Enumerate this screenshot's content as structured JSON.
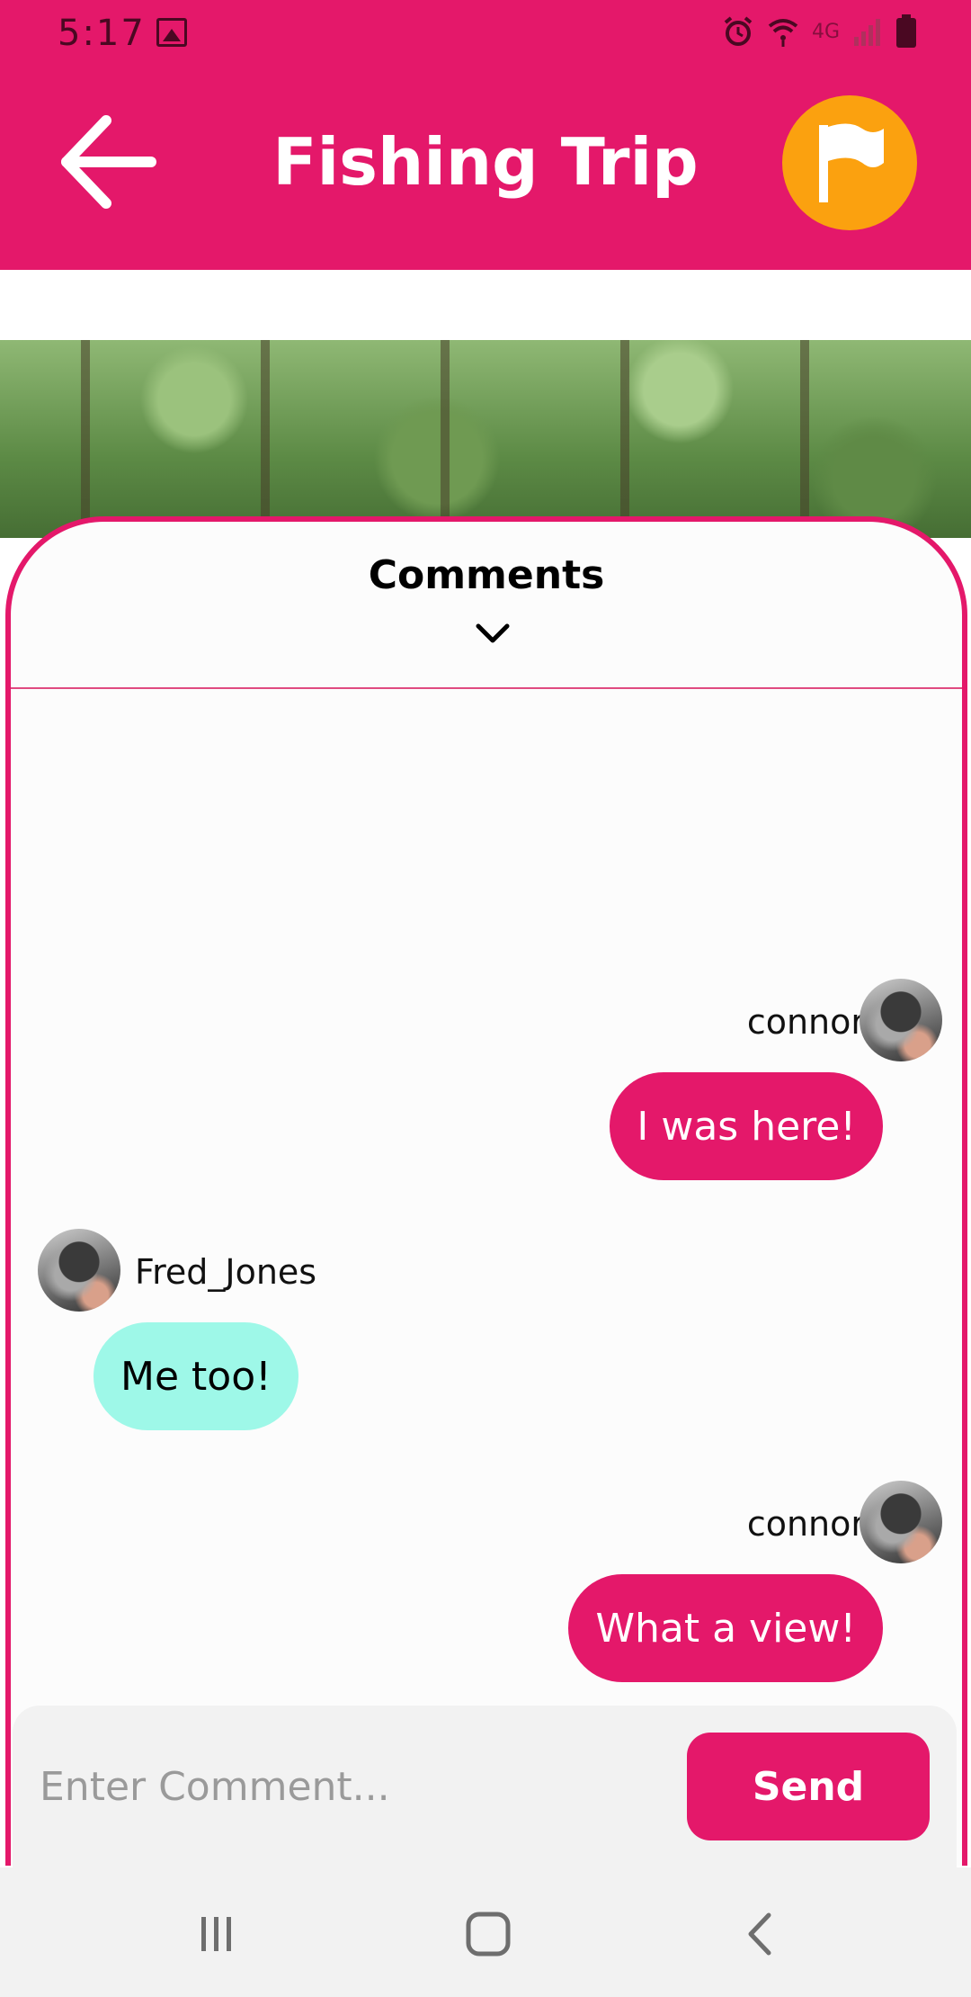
{
  "status_bar": {
    "time": "5:17",
    "network": "4G"
  },
  "header": {
    "title": "Fishing Trip",
    "back_icon": "arrow-left-icon",
    "flag_icon": "flag-icon"
  },
  "comments": {
    "title": "Comments",
    "messages": [
      {
        "user": "connor",
        "text": "I was here!",
        "direction": "outgoing"
      },
      {
        "user": "Fred_Jones",
        "text": "Me too!",
        "direction": "incoming"
      },
      {
        "user": "connor",
        "text": "What a view!",
        "direction": "outgoing"
      }
    ]
  },
  "composer": {
    "placeholder": "Enter Comment...",
    "send_label": "Send"
  },
  "colors": {
    "primary": "#e4186a",
    "flag_button": "#fba10f",
    "incoming_bubble": "#9ef8e8"
  }
}
